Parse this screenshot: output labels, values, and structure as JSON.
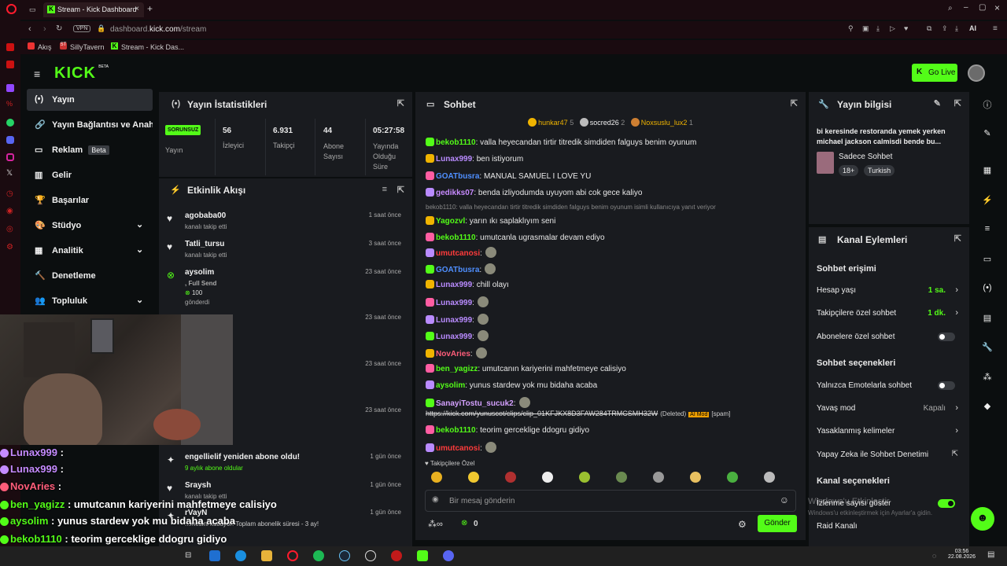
{
  "browser": {
    "tab_title": "Stream - Kick Dashboard",
    "url_prefix": "dashboard.",
    "url_host": "kick.com",
    "url_path": "/stream",
    "vpn_label": "VPN",
    "ai_label": "AI",
    "bookmarks": [
      "Akış",
      "SillyTavern",
      "Stream - Kick Das..."
    ]
  },
  "header": {
    "logo": "KICK",
    "logo_beta": "BETA",
    "go_live": "Go Live"
  },
  "sidebar": {
    "items": [
      {
        "label": "Yayın",
        "icon": "(•)"
      },
      {
        "label": "Yayın Bağlantısı ve Anahtar",
        "icon": "🔗"
      },
      {
        "label": "Reklam",
        "icon": "▭",
        "badge": "Beta"
      },
      {
        "label": "Gelir",
        "icon": "▥"
      },
      {
        "label": "Başarılar",
        "icon": "🏆"
      },
      {
        "label": "Stüdyo",
        "icon": "🎨",
        "chev": "⌄"
      },
      {
        "label": "Analitik",
        "icon": "▦",
        "chev": "⌄"
      },
      {
        "label": "Denetleme",
        "icon": "🔨"
      },
      {
        "label": "Topluluk",
        "icon": "👥",
        "chev": "⌄"
      }
    ]
  },
  "stats": {
    "title": "Yayın İstatistikleri",
    "status_badge": "SORUNSUZ",
    "status_label": "Yayın",
    "cols": [
      {
        "value": "56",
        "label": "İzleyici"
      },
      {
        "value": "6.931",
        "label": "Takipçi"
      },
      {
        "value": "44",
        "label": "Abone Sayısı"
      },
      {
        "value": "05:27:58",
        "label": "Yayında Olduğu Süre"
      }
    ]
  },
  "activity": {
    "title": "Etkinlik Akışı",
    "events": [
      {
        "name": "agobaba00",
        "sub": "kanalı takip etti",
        "time": "1 saat önce"
      },
      {
        "name": "Tatli_tursu",
        "sub": "kanalı takip etti",
        "time": "3 saat önce"
      },
      {
        "name": "aysolim",
        "sub": ", Full Send",
        "extra": "100",
        "extra2": "gönderdi",
        "time": "23 saat önce"
      },
      {
        "time": "23 saat önce"
      },
      {
        "time": "23 saat önce"
      },
      {
        "time": "23 saat önce"
      },
      {
        "name": "engellielif yeniden abone oldu!",
        "sub": "9 aylık abone oldular",
        "time": "1 gün önce"
      },
      {
        "name": "Sraysh",
        "sub": "kanalı takip etti",
        "time": "1 gün önce"
      },
      {
        "name": "rVayN",
        "sub": "...mesini kutluyor! Toplam abonelik süresi - 3 ay!",
        "time": "1 gün önce"
      }
    ]
  },
  "chat": {
    "title": "Sohbet",
    "top_gifters": [
      {
        "name": "hunkar47",
        "count": "5",
        "rank": "1"
      },
      {
        "name": "socred26",
        "count": "2",
        "rank": "2"
      },
      {
        "name": "Noxsuslu_lux2",
        "count": "1",
        "rank": "3"
      }
    ],
    "messages": [
      {
        "user": "bekob1110",
        "color": "#53fc18",
        "text": ": valla heyecandan tirtir titredik simdiden falguys benim oyunum"
      },
      {
        "user": "Lunax999",
        "color": "#b98bff",
        "text": ": ben istiyorum"
      },
      {
        "user": "GOATbusra",
        "color": "#4f8fff",
        "text": ": MANUAL SAMUEL I LOVE YU"
      },
      {
        "user": "gedikks07",
        "color": "#c88bff",
        "text": ": benda izliyodumda uyuyom abi cok gece kaliyo"
      },
      {
        "user": "",
        "color": "#888",
        "text": "bekob1110: valla heyecandan tirtir titredik simdiden falguys benim oyunum isimli kullanıcıya yanıt veriyor"
      },
      {
        "user": "Yagozvl",
        "color": "#53fc18",
        "text": ": yarın ıkı saplaklıyım seni"
      },
      {
        "user": "bekob1110",
        "color": "#53fc18",
        "text": ": umutcanla ugrasmalar devam ediyo"
      },
      {
        "user": "umutcanosi",
        "color": "#ff3b3b",
        "text": ":"
      },
      {
        "user": "GOATbusra",
        "color": "#4f8fff",
        "text": ":"
      },
      {
        "user": "Lunax999",
        "color": "#b98bff",
        "text": ": chill olayı"
      },
      {
        "user": "Lunax999",
        "color": "#b98bff",
        "text": ":"
      },
      {
        "user": "Lunax999",
        "color": "#b98bff",
        "text": ":"
      },
      {
        "user": "Lunax999",
        "color": "#b98bff",
        "text": ":"
      },
      {
        "user": "NovAries",
        "color": "#ff5d7a",
        "text": ":"
      },
      {
        "user": "ben_yagizz",
        "color": "#53fc18",
        "text": ": umutcanın kariyerini mahfetmeye calisiyo"
      },
      {
        "user": "aysolim",
        "color": "#53fc18",
        "text": ": yunus stardew yok mu bidaha acaba"
      },
      {
        "user": "SanayiTostu_sucuk2",
        "color": "#d4a0ff",
        "text": ":"
      },
      {
        "user": "",
        "color": "#ddd",
        "text": "https://kick.com/yunuscot/clips/clip_01KFJKX8D3FAW284TRMCSMH32W",
        "deleted": "(Deleted)",
        "mod": "AI Mod",
        "spam": "[spam]"
      },
      {
        "user": "bekob1110",
        "color": "#53fc18",
        "text": ": teorim gerceklige ddogru gidiyo"
      },
      {
        "user": "umutcanosi",
        "color": "#ff3b3b",
        "text": ":"
      }
    ],
    "emote_section": "Takipçilere Özel",
    "input_placeholder": "Bir mesaj gönderin",
    "points": "0",
    "send": "Gönder"
  },
  "stream_info": {
    "title": "Yayın bilgisi",
    "stream_title": "bi keresinde restoranda yemek yerken michael jackson calmisdi bende bu...",
    "category": "Sadece Sohbet",
    "tags": [
      "18+",
      "Turkish"
    ]
  },
  "channel_actions": {
    "title": "Kanal Eylemleri",
    "sec1": "Sohbet erişimi",
    "rows1": [
      {
        "label": "Hesap yaşı",
        "value": "1 sa.",
        "type": "chev"
      },
      {
        "label": "Takipçilere özel sohbet",
        "value": "1 dk.",
        "type": "chev"
      },
      {
        "label": "Abonelere özel sohbet",
        "type": "toggle",
        "on": false
      }
    ],
    "sec2": "Sohbet seçenekleri",
    "rows2": [
      {
        "label": "Yalnızca Emotelarla sohbet",
        "type": "toggle",
        "on": false
      },
      {
        "label": "Yavaş mod",
        "value": "Kapalı",
        "type": "chev"
      },
      {
        "label": "Yasaklanmış kelimeler",
        "type": "chev"
      },
      {
        "label": "Yapay Zeka ile Sohbet Denetimi",
        "type": "ext"
      }
    ],
    "sec3": "Kanal seçenekleri",
    "rows3": [
      {
        "label": "İzlenme sayısı göster",
        "type": "toggle",
        "on": true
      },
      {
        "label": "Raid Kanalı",
        "type": "none"
      }
    ]
  },
  "windows_watermark": {
    "line1": "Windows'u Etkinleştir",
    "line2": "Windows'u etkinleştirmek için Ayarlar'a gidin."
  },
  "overlay_chat": [
    {
      "user": "Lunax999",
      "color": "#c58bff",
      "text": " :"
    },
    {
      "user": "Lunax999",
      "color": "#c58bff",
      "text": " :"
    },
    {
      "user": "NovAries",
      "color": "#ff5d7a",
      "text": " :"
    },
    {
      "user": "ben_yagizz",
      "color": "#53fc18",
      "text": " : umutcanın kariyerini mahfetmeye calisiyo"
    },
    {
      "user": "aysolim",
      "color": "#53fc18",
      "text": " : yunus stardew yok mu bidaha acaba"
    },
    {
      "user": "bekob1110",
      "color": "#53fc18",
      "text": " : teorim gerceklige ddogru gidiyo"
    }
  ],
  "overlay_bottom_user": "umutcanosi",
  "clock": {
    "time": "03:56",
    "date": "22.08.2026"
  },
  "colors": {
    "kick_green": "#53fc18",
    "panel": "#191b1f",
    "bg": "#0b0e0f"
  }
}
